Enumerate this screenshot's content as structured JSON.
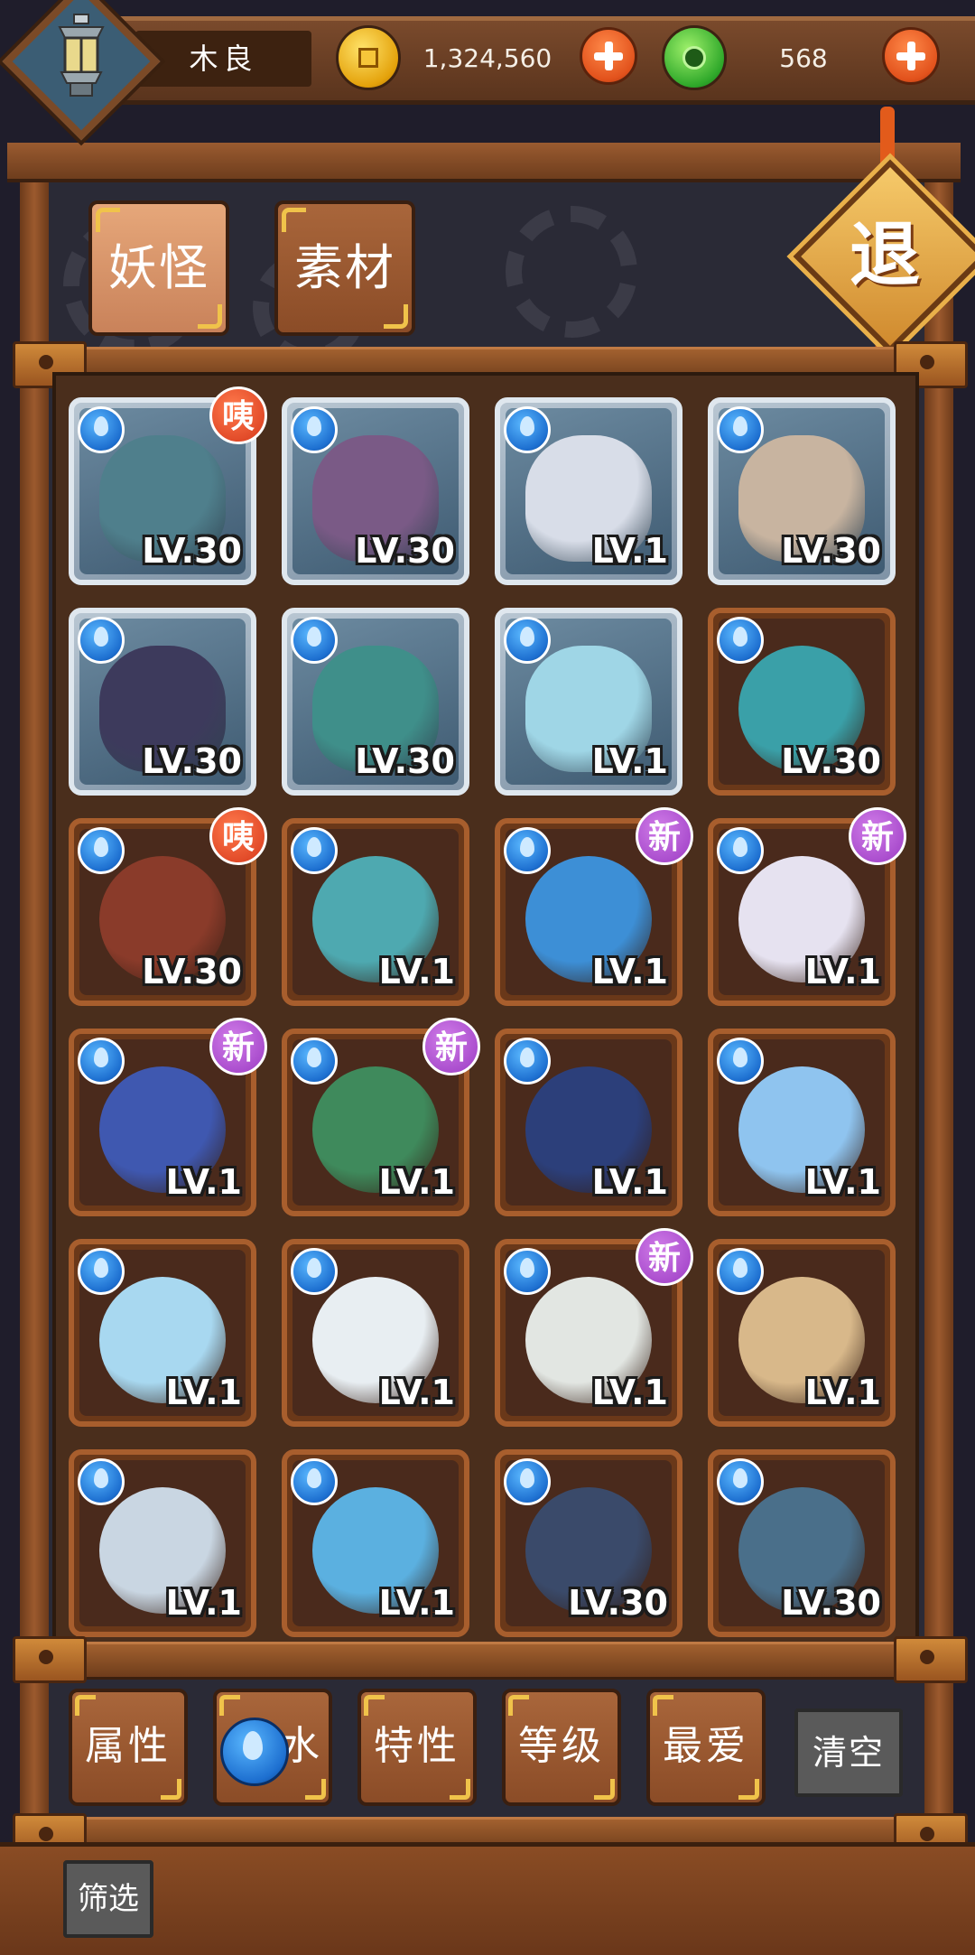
{
  "player": {
    "name": "木良"
  },
  "currency": {
    "coins": "1,324,560",
    "gems": "568"
  },
  "tabs": [
    {
      "label": "妖怪",
      "active": true
    },
    {
      "label": "素材",
      "active": false
    }
  ],
  "exit_label": "退",
  "element_icon": "water-drop-icon",
  "cards": [
    {
      "level": "LV.30",
      "frame": "gray",
      "color": "#4f7f8c",
      "badge": "咦",
      "badge_type": "hint",
      "icon": "fish-monster-icon"
    },
    {
      "level": "LV.30",
      "frame": "gray",
      "color": "#7a5a86",
      "badge": "",
      "badge_type": "",
      "icon": "bearded-general-icon"
    },
    {
      "level": "LV.1",
      "frame": "gray",
      "color": "#d8dde8",
      "badge": "",
      "badge_type": "",
      "icon": "white-hair-king-icon"
    },
    {
      "level": "LV.30",
      "frame": "gray",
      "color": "#c8b4a0",
      "badge": "",
      "badge_type": "",
      "icon": "swordsman-icon"
    },
    {
      "level": "LV.30",
      "frame": "gray",
      "color": "#3d3a5c",
      "badge": "",
      "badge_type": "",
      "icon": "samurai-girl-icon"
    },
    {
      "level": "LV.30",
      "frame": "gray",
      "color": "#3f8f8a",
      "badge": "",
      "badge_type": "",
      "icon": "dragon-icon"
    },
    {
      "level": "LV.1",
      "frame": "gray",
      "color": "#9fd6e6",
      "badge": "",
      "badge_type": "",
      "icon": "ice-spirit-icon"
    },
    {
      "level": "LV.30",
      "frame": "brown",
      "color": "#3aa0a8",
      "badge": "",
      "badge_type": "",
      "icon": "monkey-warrior-icon"
    },
    {
      "level": "LV.30",
      "frame": "brown",
      "color": "#8a3b2a",
      "badge": "咦",
      "badge_type": "hint",
      "icon": "sausage-icon"
    },
    {
      "level": "LV.1",
      "frame": "brown",
      "color": "#4ea9b0",
      "badge": "",
      "badge_type": "",
      "icon": "lizard-icon"
    },
    {
      "level": "LV.1",
      "frame": "brown",
      "color": "#3d8fd6",
      "badge": "新",
      "badge_type": "new",
      "icon": "bird-icon"
    },
    {
      "level": "LV.1",
      "frame": "brown",
      "color": "#e6e2f0",
      "badge": "新",
      "badge_type": "new",
      "icon": "feather-spirit-icon"
    },
    {
      "level": "LV.1",
      "frame": "brown",
      "color": "#3f58b0",
      "badge": "新",
      "badge_type": "new",
      "icon": "sea-slug-icon"
    },
    {
      "level": "LV.1",
      "frame": "brown",
      "color": "#3f8a5c",
      "badge": "新",
      "badge_type": "new",
      "icon": "sprout-creature-icon"
    },
    {
      "level": "LV.1",
      "frame": "brown",
      "color": "#2c3f7a",
      "badge": "",
      "badge_type": "",
      "icon": "seal-robed-icon"
    },
    {
      "level": "LV.1",
      "frame": "brown",
      "color": "#8fc4ef",
      "badge": "",
      "badge_type": "",
      "icon": "jelly-icon"
    },
    {
      "level": "LV.1",
      "frame": "brown",
      "color": "#a8d8f0",
      "badge": "",
      "badge_type": "",
      "icon": "ice-cube-man-icon"
    },
    {
      "level": "LV.1",
      "frame": "brown",
      "color": "#e8eef2",
      "badge": "",
      "badge_type": "",
      "icon": "snow-creature-icon"
    },
    {
      "level": "LV.1",
      "frame": "brown",
      "color": "#e2e6e2",
      "badge": "新",
      "badge_type": "new",
      "icon": "mahjong-tile-icon"
    },
    {
      "level": "LV.1",
      "frame": "brown",
      "color": "#d8b88a",
      "badge": "",
      "badge_type": "",
      "icon": "log-icon"
    },
    {
      "level": "LV.1",
      "frame": "brown",
      "color": "#c9d6e2",
      "badge": "",
      "badge_type": "",
      "icon": "teapot-icon"
    },
    {
      "level": "LV.1",
      "frame": "brown",
      "color": "#5bb0e0",
      "badge": "",
      "badge_type": "",
      "icon": "yeti-icon"
    },
    {
      "level": "LV.30",
      "frame": "brown",
      "color": "#3a4a6a",
      "badge": "",
      "badge_type": "",
      "icon": "walrus-hat-icon"
    },
    {
      "level": "LV.30",
      "frame": "brown",
      "color": "#4a6f8a",
      "badge": "",
      "badge_type": "",
      "icon": "rhino-warrior-icon"
    }
  ],
  "filters": [
    {
      "label": "属性",
      "icon": ""
    },
    {
      "label": "水",
      "icon": "water-drop-icon"
    },
    {
      "label": "特性",
      "icon": ""
    },
    {
      "label": "等级",
      "icon": ""
    },
    {
      "label": "最爱",
      "icon": ""
    }
  ],
  "clear_label": "清空",
  "screen_label": "筛选"
}
